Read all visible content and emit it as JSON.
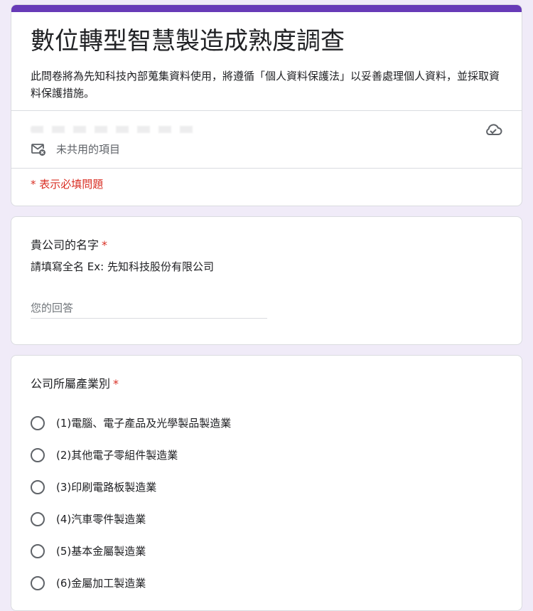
{
  "header": {
    "title": "數位轉型智慧製造成熟度調查",
    "description": "此問卷將為先知科技內部蒐集資料使用，將遵循「個人資料保護法」以妥善處理個人資料，並採取資料保護措施。",
    "not_shared_label": "未共用的項目",
    "required_note": "* 表示必填問題"
  },
  "questions": [
    {
      "title": "貴公司的名字",
      "required_mark": "*",
      "help_text": "請填寫全名 Ex: 先知科技股份有限公司",
      "placeholder": "您的回答"
    },
    {
      "title": "公司所屬產業別",
      "required_mark": "*",
      "options": [
        "(1)電腦、電子產品及光學製品製造業",
        "(2)其他電子零組件製造業",
        "(3)印刷電路板製造業",
        "(4)汽車零件製造業",
        "(5)基本金屬製造業",
        "(6)金屬加工製造業"
      ]
    }
  ],
  "colors": {
    "accent": "#673ab7",
    "background": "#f0ebf8",
    "required": "#d93025"
  }
}
